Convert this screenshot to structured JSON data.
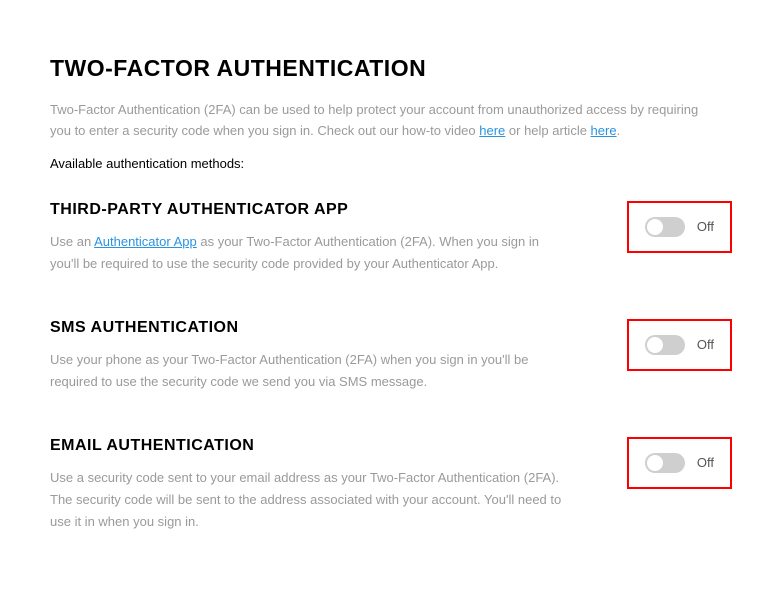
{
  "page": {
    "title": "TWO-FACTOR AUTHENTICATION",
    "intro_prefix": "Two-Factor Authentication (2FA) can be used to help protect your account from unauthorized access by requiring you to enter a security code when you sign in. Check out our how-to video ",
    "intro_link1": "here",
    "intro_middle": " or help article ",
    "intro_link2": "here",
    "intro_suffix": ".",
    "available_label": "Available authentication methods:"
  },
  "methods": {
    "authenticator": {
      "title": "THIRD-PARTY AUTHENTICATOR APP",
      "desc_prefix": "Use an ",
      "desc_link": "Authenticator App",
      "desc_suffix": " as your Two-Factor Authentication (2FA). When you sign in you'll be required to use the security code provided by your Authenticator App.",
      "toggle_label": "Off"
    },
    "sms": {
      "title": "SMS AUTHENTICATION",
      "desc": "Use your phone as your Two-Factor Authentication (2FA) when you sign in you'll be required to use the security code we send you via SMS message.",
      "toggle_label": "Off"
    },
    "email": {
      "title": "EMAIL AUTHENTICATION",
      "desc": "Use a security code sent to your email address as your Two-Factor Authentication (2FA). The security code will be sent to the address associated with your account. You'll need to use it in when you sign in.",
      "toggle_label": "Off"
    }
  }
}
